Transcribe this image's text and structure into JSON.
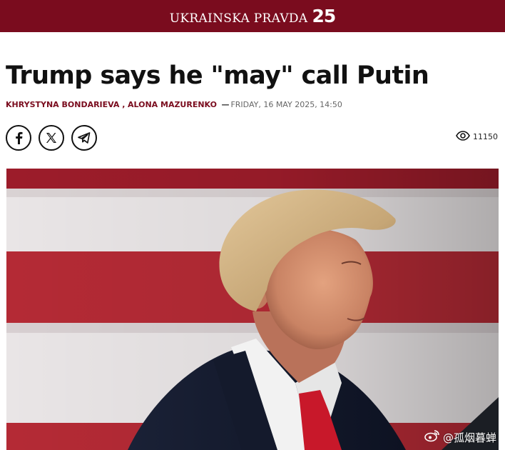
{
  "header": {
    "site_name": "UKRAINSKA PRAVDA",
    "anniversary_number": "25",
    "brand_color": "#7a0c1e"
  },
  "article": {
    "title": "Trump says he \"may\" call Putin",
    "authors": [
      "KHRYSTYNA BONDARIEVA",
      "ALONA MAZURENKO"
    ],
    "author_separator": " ,",
    "dash": "—",
    "date": "FRIDAY, 16 MAY 2025, 14:50",
    "views": "11150"
  },
  "share": {
    "buttons": [
      {
        "icon": "facebook-icon"
      },
      {
        "icon": "x-icon"
      },
      {
        "icon": "telegram-icon"
      }
    ]
  },
  "image": {
    "subject": "photo",
    "flag_colors": [
      "#b42a35",
      "#e9e5e6"
    ]
  },
  "watermark": {
    "text": "@孤烟暮蝉",
    "icon": "weibo-icon"
  }
}
